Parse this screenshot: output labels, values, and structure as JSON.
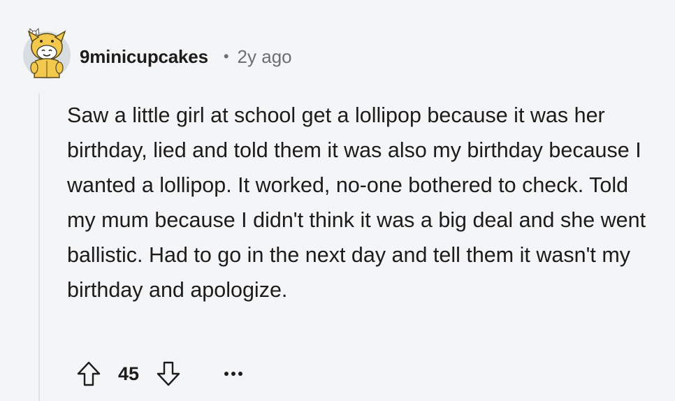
{
  "comment": {
    "author": "9minicupcakes",
    "separator": "•",
    "timestamp": "2y ago",
    "body": "Saw a little girl at school get a lollipop because it was her birthday, lied and told them it was also my birthday because I wanted a lollipop. It worked, no-one bothered to check. Told my mum because I didn't think it was a big deal and she went ballistic. Had to go in the next day and tell them it wasn't my birthday and apologize.",
    "score": "45"
  },
  "icons": {
    "avatar": "snoo-avatar-yellow-dog-hat",
    "upvote": "upvote-arrow-icon",
    "downvote": "downvote-arrow-icon",
    "more": "more-options-icon"
  },
  "colors": {
    "background": "#f4f5f6",
    "text": "#1c1c1c",
    "meta": "#6a6f73",
    "thread_line": "#dfe1e3",
    "avatar_yellow": "#f2c94c"
  }
}
